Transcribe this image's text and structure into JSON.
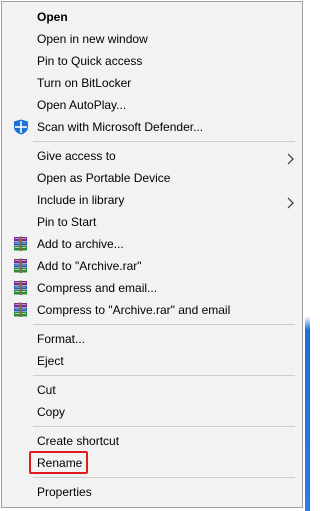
{
  "context_menu": {
    "groups": [
      {
        "items": [
          {
            "label": "Open",
            "bold": true
          },
          {
            "label": "Open in new window"
          },
          {
            "label": "Pin to Quick access"
          },
          {
            "label": "Turn on BitLocker"
          },
          {
            "label": "Open AutoPlay..."
          },
          {
            "label": "Scan with Microsoft Defender...",
            "icon": "defender-shield-icon"
          }
        ]
      },
      {
        "items": [
          {
            "label": "Give access to",
            "submenu": true
          },
          {
            "label": "Open as Portable Device"
          },
          {
            "label": "Include in library",
            "submenu": true
          },
          {
            "label": "Pin to Start"
          },
          {
            "label": "Add to archive...",
            "icon": "winrar-icon"
          },
          {
            "label": "Add to \"Archive.rar\"",
            "icon": "winrar-icon"
          },
          {
            "label": "Compress and email...",
            "icon": "winrar-icon"
          },
          {
            "label": "Compress to \"Archive.rar\" and email",
            "icon": "winrar-icon"
          }
        ]
      },
      {
        "items": [
          {
            "label": "Format..."
          },
          {
            "label": "Eject"
          }
        ]
      },
      {
        "items": [
          {
            "label": "Cut"
          },
          {
            "label": "Copy"
          }
        ]
      },
      {
        "items": [
          {
            "label": "Create shortcut"
          },
          {
            "label": "Rename",
            "highlighted": true
          }
        ]
      },
      {
        "items": [
          {
            "label": "Properties"
          }
        ]
      }
    ]
  },
  "colors": {
    "menu_background": "#f2f2f2",
    "highlight_border": "#e01b1b",
    "desktop_accent": "#1d6fd8"
  }
}
